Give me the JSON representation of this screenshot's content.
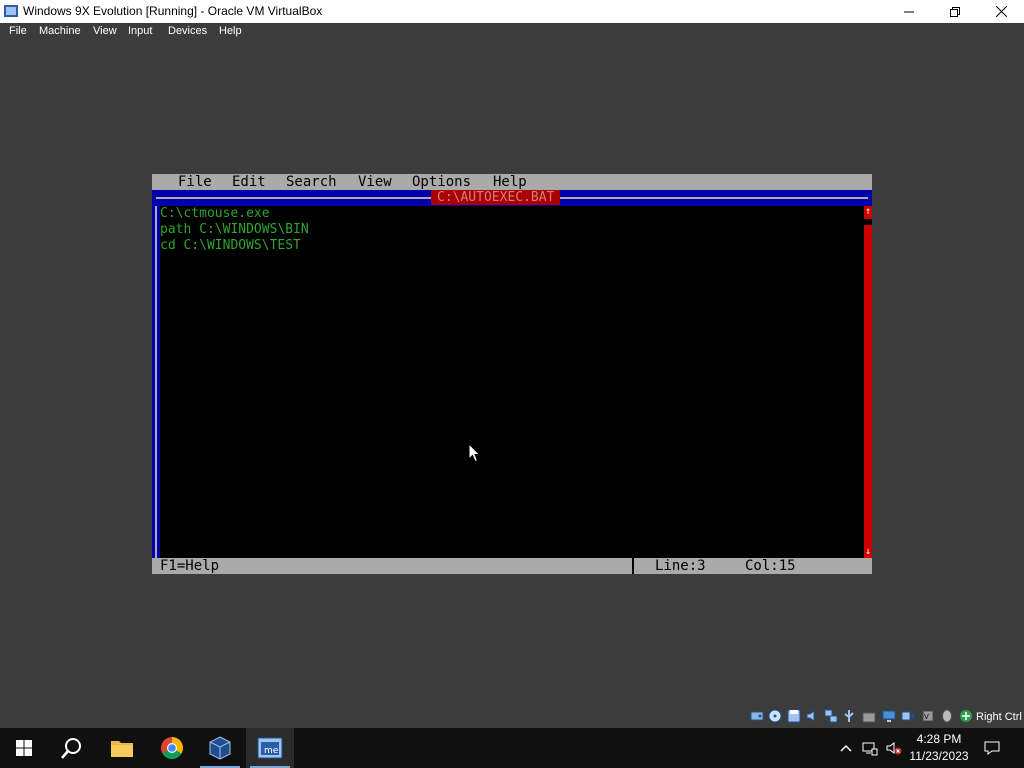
{
  "window": {
    "title": "Windows 9X Evolution [Running] - Oracle VM VirtualBox",
    "menu": [
      "File",
      "Machine",
      "View",
      "Input",
      "Devices",
      "Help"
    ]
  },
  "editor": {
    "menu": [
      "File",
      "Edit",
      "Search",
      "View",
      "Options",
      "Help"
    ],
    "filename": "C:\\AUTOEXEC.BAT",
    "lines": [
      "C:\\ctmouse.exe",
      "path C:\\WINDOWS\\BIN",
      "cd C:\\WINDOWS\\TEST"
    ],
    "status": {
      "help": "F1=Help",
      "line": "Line:3",
      "col": "Col:15"
    }
  },
  "vbox_tray": {
    "icons": [
      "hard-disk-icon",
      "optical-drive-icon",
      "floppy-icon",
      "audio-icon",
      "network-icon",
      "usb-icon",
      "shared-folders-icon",
      "display-icon",
      "recording-icon",
      "cpu-icon",
      "mouse-integration-icon",
      "keyboard-icon"
    ],
    "host_key": "Right Ctrl"
  },
  "taskbar": {
    "apps": [
      "start-icon",
      "search-icon",
      "file-explorer-icon",
      "chrome-icon",
      "virtualbox-icon",
      "vm-window-icon"
    ],
    "time": "4:28 PM",
    "date": "11/23/2023"
  },
  "colors": {
    "dos_blue": "#0000aa",
    "dos_gray": "#aaaaaa",
    "dos_red": "#aa0000",
    "dos_text_green": "#2ea52e",
    "vm_background": "#3c3c3c"
  }
}
